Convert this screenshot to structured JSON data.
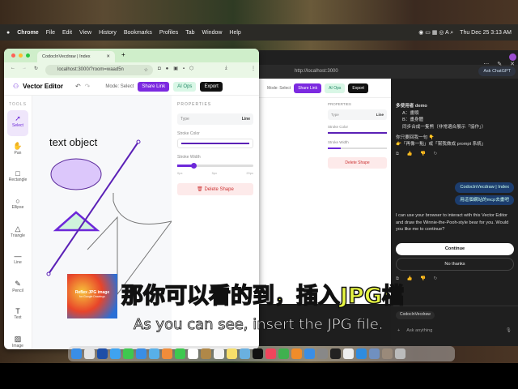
{
  "menubar": {
    "app": "Chrome",
    "items": [
      "File",
      "Edit",
      "View",
      "History",
      "Bookmarks",
      "Profiles",
      "Tab",
      "Window",
      "Help"
    ],
    "clock": "Thu Dec 25  3:13 AM"
  },
  "browser": {
    "tab_title": "CodocInVecdraw | Index",
    "url": "localhost:3000/?room=waad5n"
  },
  "editor": {
    "title": "Vector Editor",
    "mode": "Mode: Select",
    "share": "Share Link",
    "ai": "AI Ops",
    "export": "Export",
    "tools_heading": "TOOLS",
    "tools": [
      "Select",
      "Pan",
      "Rectangle",
      "Ellipse",
      "Triangle",
      "Line",
      "Pencil",
      "Text",
      "Image"
    ],
    "canvas_text": "text object",
    "image_title": "Reflex JPG image",
    "image_sub": "for Google Drawings",
    "props": {
      "heading": "PROPERTIES",
      "type_label": "Type",
      "type_value": "Line",
      "stroke_color": "Stroke Color",
      "stroke_color_value": "#5b21b6",
      "stroke_width": "Stroke Width",
      "stroke_width_value": 4,
      "min": "0px",
      "mid": "5px",
      "max": "20px",
      "delete": "Delete Shape"
    }
  },
  "back_window": {
    "url": "http://localhost:3000",
    "ask": "Ask ChatGPT"
  },
  "chat": {
    "heading": "多使用者 demo",
    "bullets": [
      "A：畫頭",
      "B：畫身體",
      "同步合成一隻熊（非常適合展示「協作」）"
    ],
    "prompt": "你只要回我一句 👇",
    "reply_hint": "👉「再像一點」或「幫我做成 prompt 系統」",
    "user_chip": "CodocInVecdraw | Index",
    "user_msg": "用這個網站的mcp去畫吧",
    "assistant": "I can use your browser to interact with this Vector Editor and draw the Winnie-the-Pooh-style bear for you. Would you like me to continue?",
    "continue": "Continue",
    "no_thanks": "No thanks",
    "context_chip": "CodocInVecdraw",
    "placeholder": "Ask anything"
  },
  "subtitles": {
    "zh": "那你可以看的到，插入JPG檔",
    "en": "As you can see, insert the JPG file."
  }
}
